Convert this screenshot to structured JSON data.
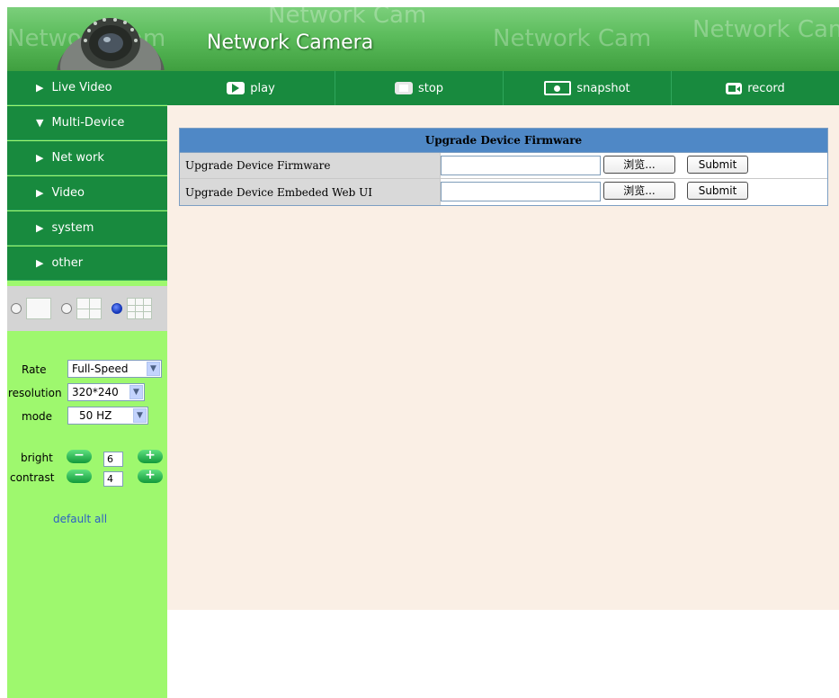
{
  "header": {
    "title": "Network Camera",
    "watermark": "Network Cam"
  },
  "sidebar": {
    "items": [
      {
        "label": "Live Video",
        "arrow": "▶"
      },
      {
        "label": "Multi-Device",
        "arrow": "▼"
      },
      {
        "label": "Net work",
        "arrow": "▶"
      },
      {
        "label": "Video",
        "arrow": "▶"
      },
      {
        "label": "system",
        "arrow": "▶"
      },
      {
        "label": "other",
        "arrow": "▶"
      }
    ],
    "layout_options": [
      "single-view",
      "quad-view",
      "nine-view"
    ],
    "layout_selected": "nine-view",
    "controls": {
      "rate_label": "Rate",
      "rate_value": "Full-Speed",
      "resolution_label": "resolution",
      "resolution_value": "320*240",
      "mode_label": "mode",
      "mode_value": "50 HZ",
      "bright_label": "bright",
      "bright_value": "6",
      "contrast_label": "contrast",
      "contrast_value": "4",
      "minus_glyph": "−",
      "plus_glyph": "+",
      "default_all": "default all"
    }
  },
  "toolbar": {
    "play": "play",
    "stop": "stop",
    "snapshot": "snapshot",
    "record": "record"
  },
  "firmware": {
    "header": "Upgrade Device Firmware",
    "rows": [
      {
        "label": "Upgrade Device Firmware",
        "browse": "浏览...",
        "submit": "Submit"
      },
      {
        "label": "Upgrade Device Embeded Web UI",
        "browse": "浏览...",
        "submit": "Submit"
      }
    ]
  },
  "colors": {
    "nav_green": "#188a3e",
    "sidebar_bg": "#9ef86e",
    "content_bg": "#faefe5",
    "table_header": "#4f88c6"
  }
}
